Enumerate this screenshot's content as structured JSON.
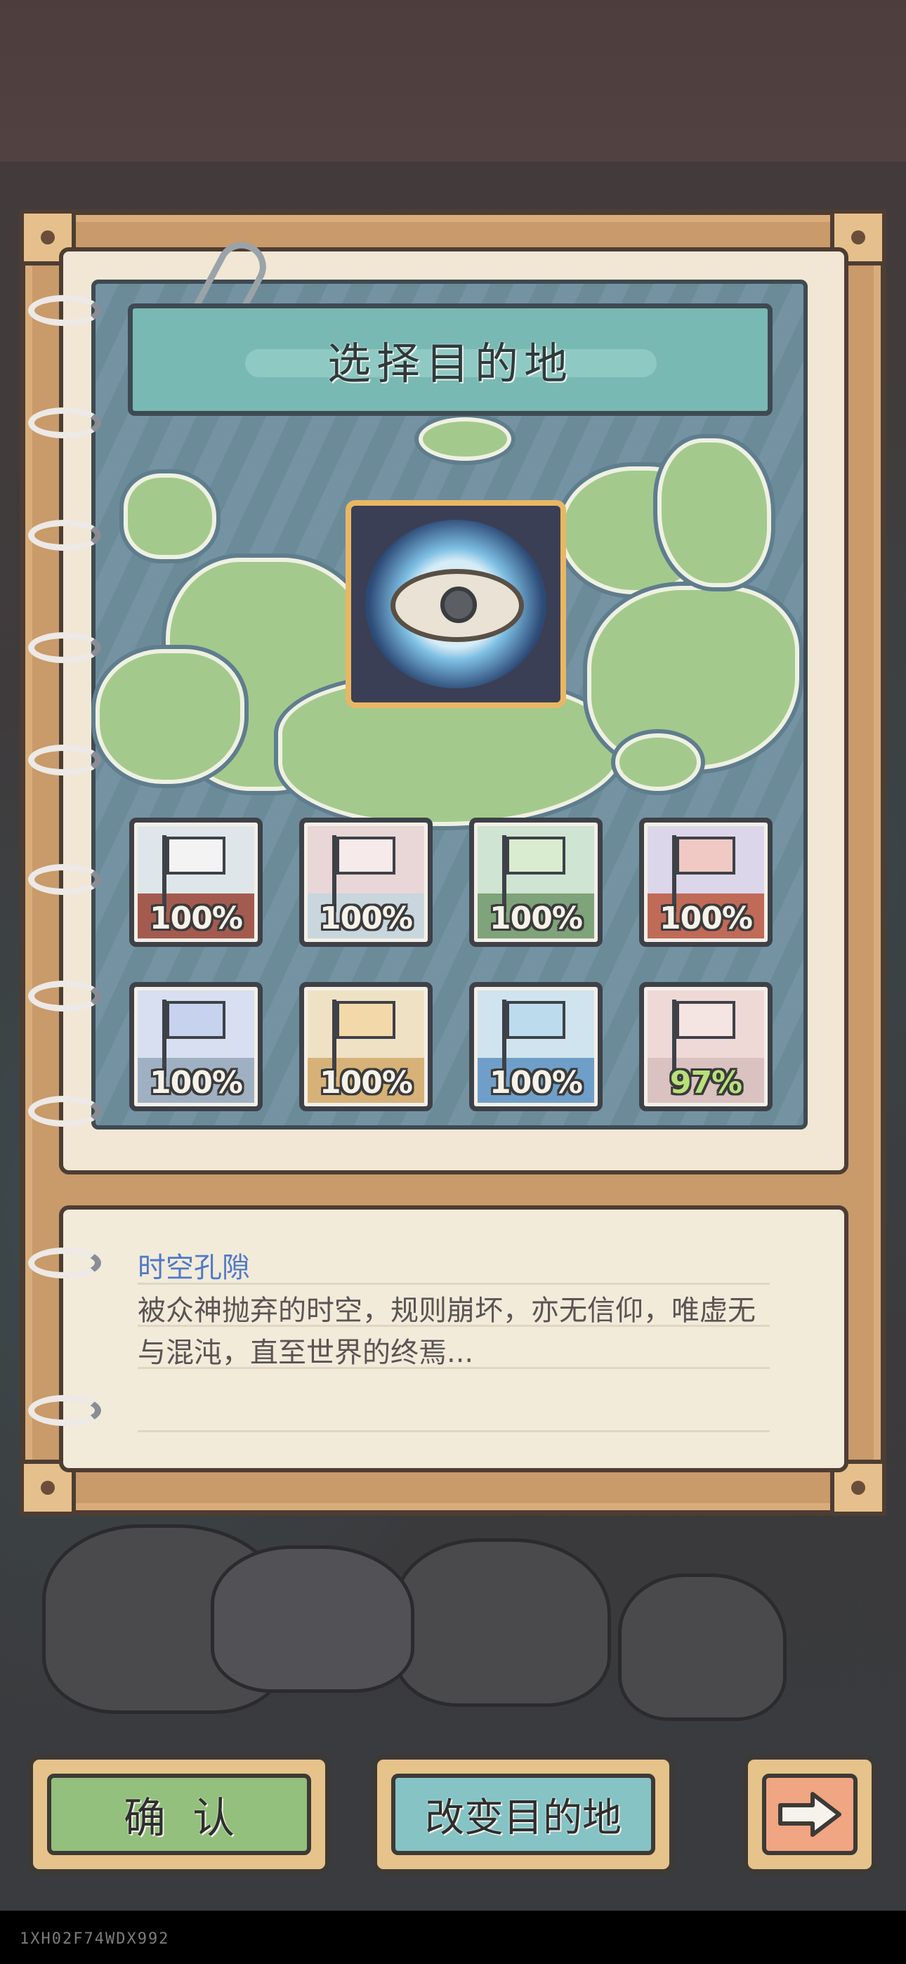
{
  "dialog": {
    "title": "选择目的地"
  },
  "portal": {
    "name": "时空孔隙",
    "icon": "eye-portal-icon"
  },
  "destinations": [
    {
      "progress": "100%",
      "flag_icon": "east-asia-flag-icon",
      "progress_color": "#f6f2ea"
    },
    {
      "progress": "100%",
      "flag_icon": "japan-flag-icon",
      "progress_color": "#f6f2ea"
    },
    {
      "progress": "100%",
      "flag_icon": "china-flag-icon",
      "progress_color": "#f6f2ea"
    },
    {
      "progress": "100%",
      "flag_icon": "usa-flag-icon",
      "progress_color": "#f6f2ea"
    },
    {
      "progress": "100%",
      "flag_icon": "uk-flag-icon",
      "progress_color": "#f6f2ea"
    },
    {
      "progress": "100%",
      "flag_icon": "egypt-flag-icon",
      "progress_color": "#f6f2ea"
    },
    {
      "progress": "100%",
      "flag_icon": "greece-flag-icon",
      "progress_color": "#f6f2ea"
    },
    {
      "progress": "97%",
      "flag_icon": "india-flag-icon",
      "progress_color": "#b8e07a"
    }
  ],
  "description": {
    "title": "时空孔隙",
    "body": "被众神抛弃的时空，规则崩坏，亦无信仰，唯虚无与混沌，直至世界的终焉..."
  },
  "buttons": {
    "confirm": "确  认",
    "change": "改变目的地",
    "next_icon": "arrow-right-icon"
  },
  "build_id": "1XH02F74WDX992"
}
